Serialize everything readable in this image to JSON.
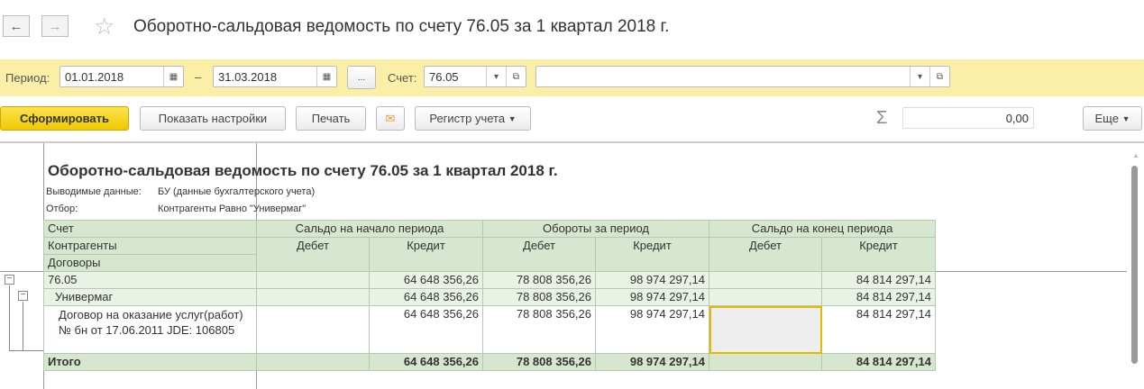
{
  "window": {
    "title": "Оборотно-сальдовая ведомость по счету 76.05 за 1 квартал 2018 г.",
    "back": "←",
    "forward": "→",
    "star": "☆"
  },
  "filters": {
    "period_label": "Период:",
    "date_from": "01.01.2018",
    "dash": "–",
    "date_to": "31.03.2018",
    "ellipsis": "...",
    "account_label": "Счет:",
    "account": "76.05",
    "subconto": ""
  },
  "toolbar": {
    "generate": "Сформировать",
    "settings": "Показать настройки",
    "print": "Печать",
    "register": "Регистр учета",
    "sum_symbol": "Σ",
    "sum_value": "0,00",
    "more": "Еще"
  },
  "report": {
    "title": "Оборотно-сальдовая ведомость по счету 76.05 за 1 квартал 2018 г.",
    "output_label": "Выводимые данные:",
    "output_value": "БУ (данные бухгалтерского учета)",
    "filter_label": "Отбор:",
    "filter_value": "Контрагенты Равно \"Универмаг\"",
    "headers": {
      "account": "Счет",
      "counterparties": "Контрагенты",
      "contracts": "Договоры",
      "opening": "Сальдо на начало периода",
      "turnover": "Обороты за период",
      "closing": "Сальдо на конец периода",
      "debit": "Дебет",
      "credit": "Кредит"
    },
    "rows": [
      {
        "name": "76.05",
        "values": [
          "",
          "64 648 356,26",
          "78 808 356,26",
          "98 974 297,14",
          "",
          "84 814 297,14"
        ]
      },
      {
        "name": "Универмаг",
        "values": [
          "",
          "64 648 356,26",
          "78 808 356,26",
          "98 974 297,14",
          "",
          "84 814 297,14"
        ]
      },
      {
        "name": "Договор на оказание услуг(работ) № бн от 17.06.2011 JDE: 106805",
        "values": [
          "",
          "64 648 356,26",
          "78 808 356,26",
          "98 974 297,14",
          "",
          "84 814 297,14"
        ]
      }
    ],
    "total": {
      "name": "Итого",
      "values": [
        "",
        "64 648 356,26",
        "78 808 356,26",
        "98 974 297,14",
        "",
        "84 814 297,14"
      ]
    }
  }
}
